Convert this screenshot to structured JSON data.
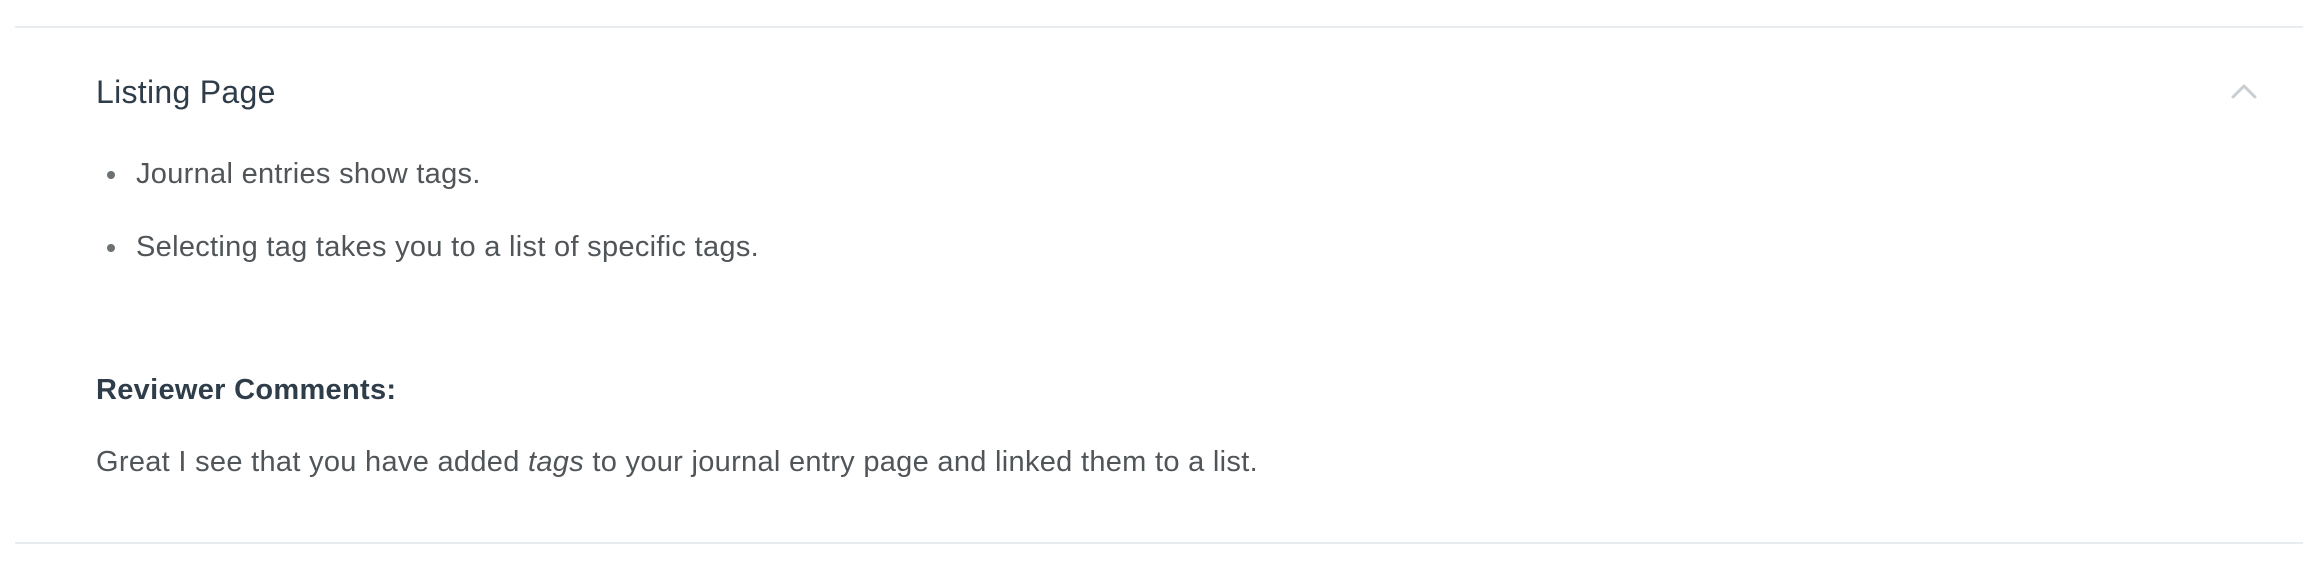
{
  "section": {
    "title": "Listing Page",
    "toggle_icon": "chevron-up-icon",
    "criteria": [
      "Journal entries show tags.",
      "Selecting tag takes you to a list of specific tags."
    ]
  },
  "reviewer": {
    "heading": "Reviewer Comments:",
    "comment_before": "Great I see that you have added ",
    "comment_emphasis": "tags",
    "comment_after": " to your journal entry page and linked them to a list."
  },
  "colors": {
    "title": "#2e3d49",
    "body_text": "#4f5559",
    "divider": "#e9ecee",
    "chevron": "#c9ced2"
  }
}
